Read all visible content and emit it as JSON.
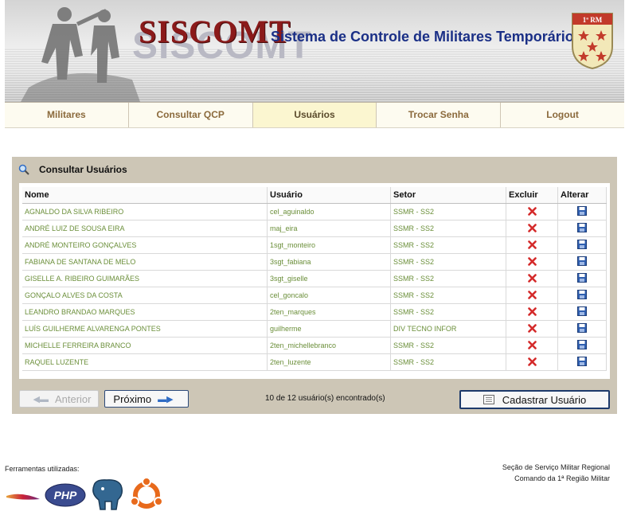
{
  "header": {
    "logo_text": "SISCOMT",
    "subtitle": "Sistema de Controle de Militares Temporários",
    "crest_text": "1ª RM"
  },
  "nav": {
    "tabs": [
      {
        "label": "Militares",
        "active": false
      },
      {
        "label": "Consultar QCP",
        "active": false
      },
      {
        "label": "Usuários",
        "active": true
      },
      {
        "label": "Trocar Senha",
        "active": false
      },
      {
        "label": "Logout",
        "active": false
      }
    ]
  },
  "panel": {
    "title": "Consultar Usuários",
    "columns": [
      "Nome",
      "Usuário",
      "Setor",
      "Excluir",
      "Alterar"
    ],
    "rows": [
      {
        "nome": "AGNALDO DA SILVA RIBEIRO",
        "usuario": "cel_aguinaldo",
        "setor": "SSMR - SS2"
      },
      {
        "nome": "ANDRÉ LUIZ DE SOUSA EIRA",
        "usuario": "maj_eira",
        "setor": "SSMR - SS2"
      },
      {
        "nome": "ANDRÉ MONTEIRO GONÇALVES",
        "usuario": "1sgt_monteiro",
        "setor": "SSMR - SS2"
      },
      {
        "nome": "FABIANA DE SANTANA DE MELO",
        "usuario": "3sgt_fabiana",
        "setor": "SSMR - SS2"
      },
      {
        "nome": "GISELLE A. RIBEIRO GUIMARÃES",
        "usuario": "3sgt_giselle",
        "setor": "SSMR - SS2"
      },
      {
        "nome": "GONÇALO ALVES DA COSTA",
        "usuario": "cel_goncalo",
        "setor": "SSMR - SS2"
      },
      {
        "nome": "LEANDRO BRANDAO MARQUES",
        "usuario": "2ten_marques",
        "setor": "SSMR - SS2"
      },
      {
        "nome": "LUÍS GUILHERME ALVARENGA PONTES",
        "usuario": "guilherme",
        "setor": "DIV TECNO INFOR"
      },
      {
        "nome": "MICHELLE FERREIRA BRANCO",
        "usuario": "2ten_michellebranco",
        "setor": "SSMR - SS2"
      },
      {
        "nome": "RAQUEL LUZENTE",
        "usuario": "2ten_luzente",
        "setor": "SSMR - SS2"
      }
    ],
    "prev_label": "Anterior",
    "next_label": "Próximo",
    "count_text": "10 de 12 usuário(s) encontrado(s)",
    "add_label": "Cadastrar Usuário"
  },
  "footer": {
    "tools_label": "Ferramentas utilizadas:",
    "org_line1": "Seção de Serviço Militar Regional",
    "org_line2": "Comando da 1ª Região Militar",
    "php_text": "PHP"
  },
  "icons": {
    "search": "magnifier-icon",
    "delete": "red-x-icon",
    "edit": "floppy-disk-icon"
  },
  "colors": {
    "brand_red": "#8b1a1a",
    "subtitle_blue": "#1a2f86",
    "panel_bg": "#cdc6b6",
    "row_text": "#6b8f3a",
    "nav_active": "#fbf6d0"
  }
}
